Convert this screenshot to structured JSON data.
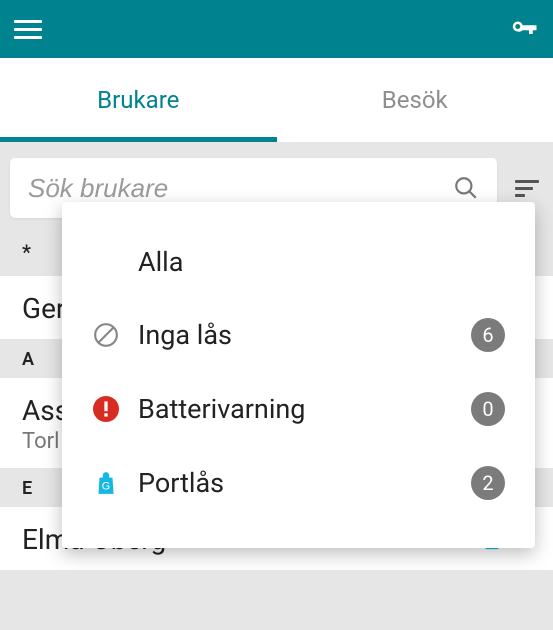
{
  "header": {},
  "tabs": {
    "active_label": "Brukare",
    "inactive_label": "Besök"
  },
  "search": {
    "placeholder": "Sök brukare"
  },
  "filter_menu": {
    "items": [
      {
        "label": "Alla",
        "count": null,
        "icon": null
      },
      {
        "label": "Inga lås",
        "count": "6",
        "icon": "prohibit"
      },
      {
        "label": "Batterivarning",
        "count": "0",
        "icon": "alert"
      },
      {
        "label": "Portlås",
        "count": "2",
        "icon": "bag"
      }
    ]
  },
  "sections": {
    "star": "*",
    "star_item_primary": "Ger",
    "a": "A",
    "a_item_primary": "Ass",
    "a_item_secondary": "Torl",
    "e": "E",
    "e_item_primary": "Elma Öberg"
  }
}
